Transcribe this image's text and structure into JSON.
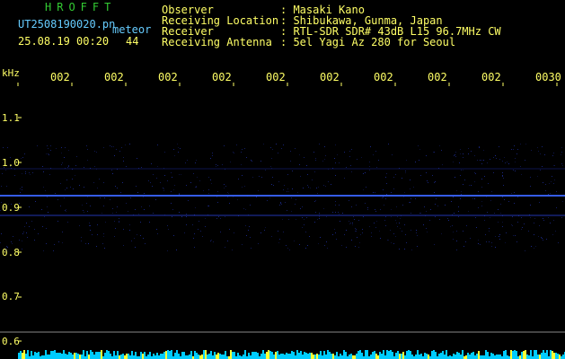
{
  "header": {
    "logo": "HROFFT",
    "filename": "UT2508190020.pn",
    "event_label": "meteor",
    "datetime": "25.08.19 00:20",
    "event_count": "44",
    "info": [
      {
        "key": "Observer",
        "value": ": Masaki Kano"
      },
      {
        "key": "Receiving Location",
        "value": ": Shibukawa, Gunma, Japan"
      },
      {
        "key": "Receiver",
        "value": ": RTL-SDR SDR# 43dB L15 96.7MHz CW"
      },
      {
        "key": "Receiving Antenna",
        "value": ": 5el Yagi Az 280 for Seoul"
      }
    ]
  },
  "spectrogram": {
    "y_unit": "kHz",
    "y_ticks": [
      "1.1",
      "1.0",
      "0.9",
      "0.8",
      "0.7",
      "0.6"
    ],
    "x_ticks": [
      "002",
      "002",
      "002",
      "002",
      "002",
      "002",
      "002",
      "002",
      "002",
      "0030"
    ],
    "colors": {
      "background": "#000000",
      "signal": "#3355ff",
      "axis": "#ffff66",
      "base": "#00ccff"
    }
  }
}
